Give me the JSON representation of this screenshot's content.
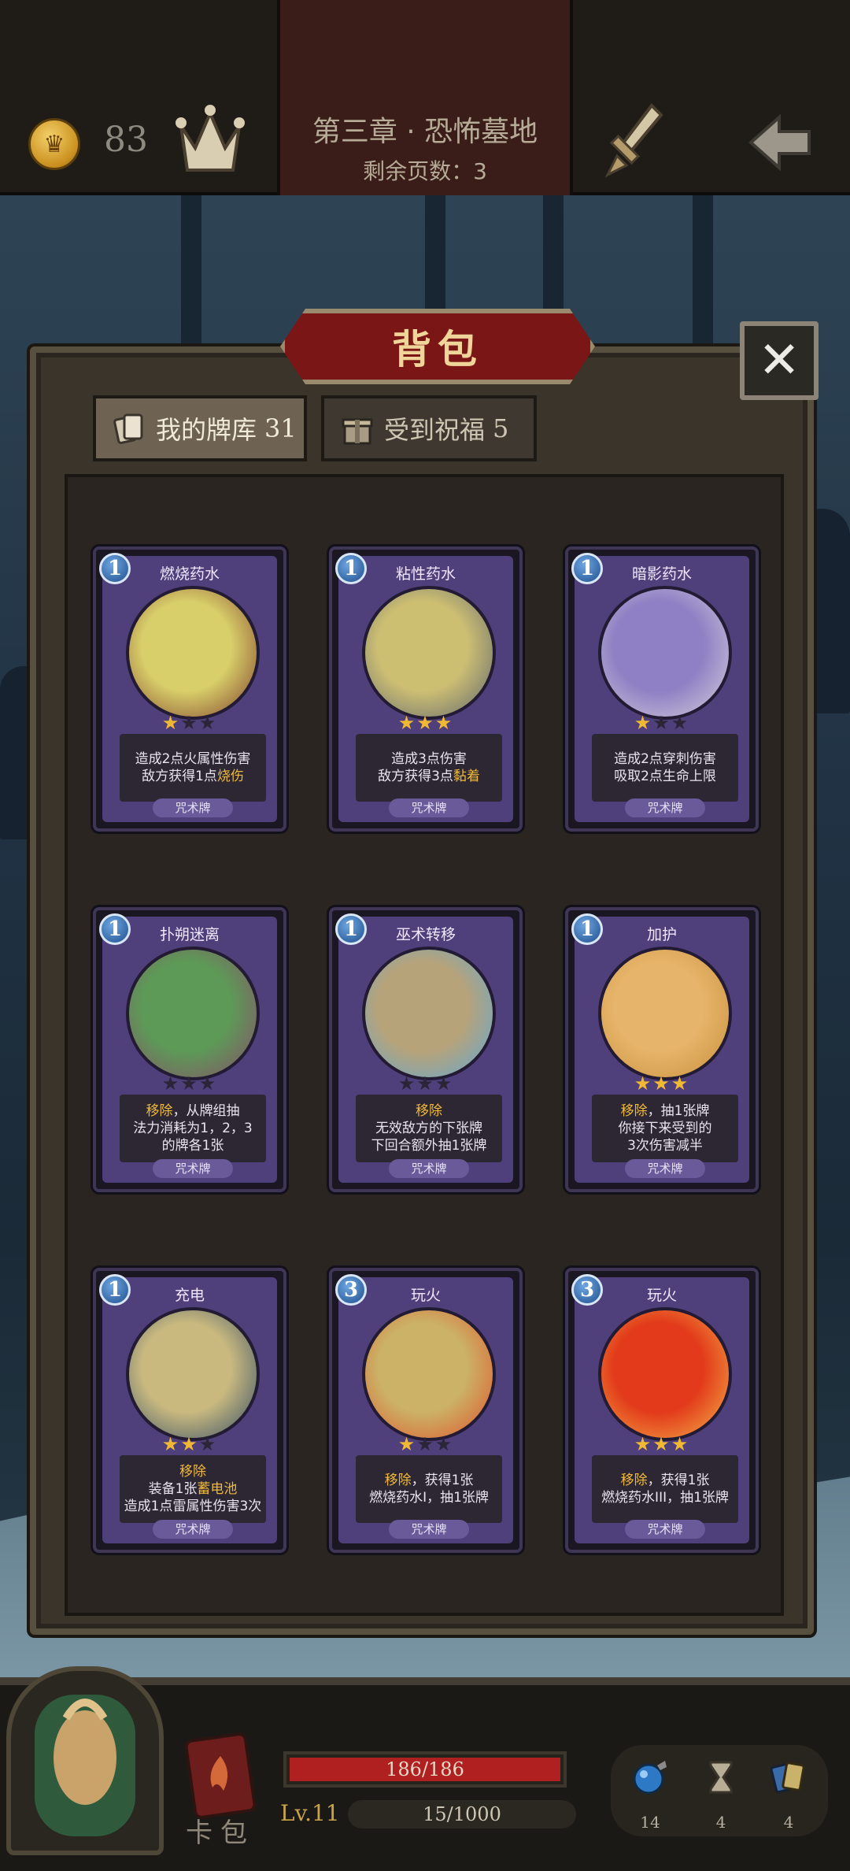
{
  "header": {
    "gold": "83",
    "chapter": "第三章 · 恐怖墓地",
    "pages_left": "剩余页数：3"
  },
  "panel": {
    "title": "背包",
    "tabs": [
      {
        "label": "我的牌库",
        "count": "31",
        "icon": "cards-icon",
        "selected": true
      },
      {
        "label": "受到祝福",
        "count": "5",
        "icon": "gift-icon",
        "selected": false
      }
    ]
  },
  "cards": [
    {
      "cost": "1",
      "name": "燃烧药水",
      "stars": 1,
      "desc": [
        [
          "造成2点火属性伤害"
        ],
        [
          "敌方获得1点",
          "@烧伤"
        ]
      ],
      "type": "咒术牌",
      "art": [
        "#d9cf6a",
        "#7a3a2a"
      ]
    },
    {
      "cost": "1",
      "name": "粘性药水",
      "stars": 3,
      "desc": [
        [
          "造成3点伤害"
        ],
        [
          "敌方获得3点",
          "@黏着"
        ]
      ],
      "type": "咒术牌",
      "art": [
        "#cdbf72",
        "#5c6270"
      ]
    },
    {
      "cost": "1",
      "name": "暗影药水",
      "stars": 1,
      "desc": [
        [
          "造成2点穿刺伤害"
        ],
        [
          "吸取2点生命上限"
        ]
      ],
      "type": "咒术牌",
      "art": [
        "#8f7fc4",
        "#d8d2dc"
      ]
    },
    {
      "cost": "1",
      "name": "扑朔迷离",
      "stars": 0,
      "desc": [
        [
          "@移除",
          "，从牌组抽"
        ],
        [
          "法力消耗为1，2，3"
        ],
        [
          "的牌各1张"
        ]
      ],
      "type": "咒术牌",
      "art": [
        "#5d9a57",
        "#8a4a6a"
      ]
    },
    {
      "cost": "1",
      "name": "巫术转移",
      "stars": 0,
      "desc": [
        [
          "@移除"
        ],
        [
          "无效敌方的下张牌"
        ],
        [
          "下回合额外抽1张牌"
        ]
      ],
      "type": "咒术牌",
      "art": [
        "#b7a37a",
        "#5fa8d6"
      ]
    },
    {
      "cost": "1",
      "name": "加护",
      "stars": 3,
      "desc": [
        [
          "@移除",
          "，抽1张牌"
        ],
        [
          "你接下来受到的"
        ],
        [
          "3次伤害减半"
        ]
      ],
      "type": "咒术牌",
      "art": [
        "#e6b46a",
        "#c98f3a"
      ]
    },
    {
      "cost": "1",
      "name": "充电",
      "stars": 2,
      "desc": [
        [
          "@移除"
        ],
        [
          "装备1张",
          "@蓄电池"
        ],
        [
          "造成1点雷属性伤害3次"
        ]
      ],
      "type": "咒术牌",
      "art": [
        "#c9b97f",
        "#2f4a66"
      ]
    },
    {
      "cost": "3",
      "name": "玩火",
      "stars": 1,
      "desc": [
        [
          "@移除",
          "，获得1张"
        ],
        [
          "燃烧药水I，抽1张牌"
        ]
      ],
      "type": "咒术牌",
      "art": [
        "#cbb266",
        "#e0502a"
      ]
    },
    {
      "cost": "3",
      "name": "玩火",
      "stars": 3,
      "desc": [
        [
          "@移除",
          "，获得1张"
        ],
        [
          "燃烧药水III，抽1张牌"
        ]
      ],
      "type": "咒术牌",
      "art": [
        "#e23a1a",
        "#f6b64a"
      ]
    }
  ],
  "footer": {
    "deck_label": "卡包",
    "hp": {
      "current": 186,
      "max": 186,
      "text": "186/186"
    },
    "level": "Lv.11",
    "xp": {
      "current": 15,
      "max": 1000,
      "text": "15/1000"
    },
    "stats": [
      {
        "icon": "potion-orb-icon",
        "value": "14"
      },
      {
        "icon": "hourglass-icon",
        "value": "4"
      },
      {
        "icon": "card-stack-icon",
        "value": "4"
      }
    ]
  },
  "colors": {
    "accent": "#f0b93a",
    "card_frame": "#4f3f7a",
    "hp": "#b02020",
    "title_plate": "#7a1616"
  }
}
